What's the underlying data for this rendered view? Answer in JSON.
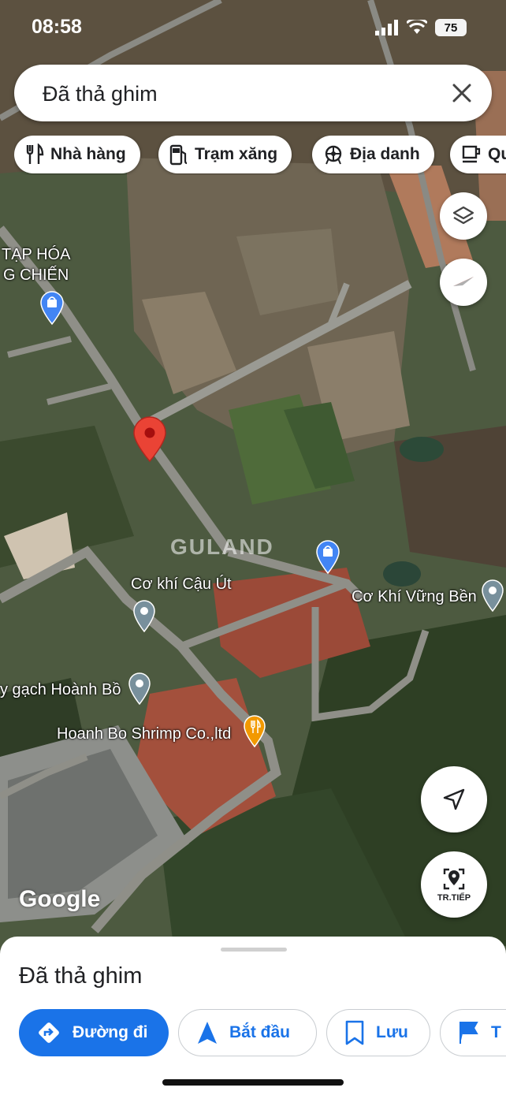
{
  "status_bar": {
    "time": "08:58",
    "battery": "75"
  },
  "search": {
    "text": "Đã thả ghim"
  },
  "chips": [
    {
      "label": "Nhà hàng",
      "icon": "restaurant-icon"
    },
    {
      "label": "Trạm xăng",
      "icon": "gas-station-icon"
    },
    {
      "label": "Địa danh",
      "icon": "landmark-icon"
    },
    {
      "label": "Qu",
      "icon": "coffee-icon"
    }
  ],
  "map_labels": {
    "tap_hoa_1": "TẠP HÓA",
    "tap_hoa_2": "G CHIẾN",
    "co_khi_cau_ut": "Cơ khí Cậu Út",
    "co_khi_vung_ben": "Cơ Khí Vững Bền",
    "gach_hoanh_bo": "y gạch Hoành Bồ",
    "shrimp": "Hoanh Bo Shrimp Co.,ltd",
    "watermark": "GULAND",
    "google": "Google"
  },
  "navigate_button": {
    "label": "TR.TIẾP"
  },
  "sheet": {
    "title": "Đã thả ghim",
    "buttons": [
      {
        "label": "Đường đi",
        "icon": "directions-icon"
      },
      {
        "label": "Bắt đầu",
        "icon": "navigation-arrow-icon"
      },
      {
        "label": "Lưu",
        "icon": "bookmark-icon"
      },
      {
        "label": "T",
        "icon": "flag-icon"
      }
    ]
  },
  "colors": {
    "accent": "#1a73e8",
    "pin": "#ea4335",
    "poi_blue": "#4285f4",
    "poi_orange": "#f29900"
  }
}
